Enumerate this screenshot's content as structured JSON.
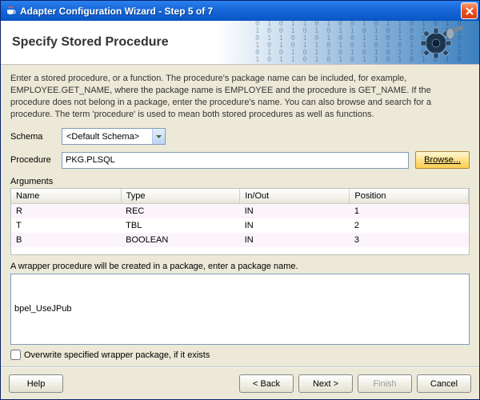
{
  "window": {
    "title": "Adapter Configuration Wizard - Step 5 of 7"
  },
  "header": {
    "title": "Specify Stored Procedure"
  },
  "description": "Enter a stored procedure, or a function. The procedure's package name can be included, for example, EMPLOYEE.GET_NAME, where the package name is EMPLOYEE and the procedure is GET_NAME.  If the procedure does not belong in a package, enter the procedure's name. You can also browse and search for a procedure. The term 'procedure' is used to mean both stored procedures as well as functions.",
  "form": {
    "schema_label": "Schema",
    "schema_value": "<Default Schema>",
    "procedure_label": "Procedure",
    "procedure_value": "PKG.PLSQL",
    "browse_label": "Browse...",
    "arguments_label": "Arguments"
  },
  "table": {
    "columns": {
      "name": "Name",
      "type": "Type",
      "inout": "In/Out",
      "position": "Position"
    },
    "rows": [
      {
        "name": "R",
        "type": "REC",
        "inout": "IN",
        "position": "1"
      },
      {
        "name": "T",
        "type": "TBL",
        "inout": "IN",
        "position": "2"
      },
      {
        "name": "B",
        "type": "BOOLEAN",
        "inout": "IN",
        "position": "3"
      }
    ]
  },
  "wrapper": {
    "caption": "A wrapper procedure will be created in a package, enter a package name.",
    "value": "bpel_UseJPub",
    "checkbox_label": "Overwrite specified wrapper package, if it exists",
    "checkbox_checked": false
  },
  "footer": {
    "help": "Help",
    "back": "< Back",
    "next": "Next >",
    "finish": "Finish",
    "cancel": "Cancel"
  }
}
